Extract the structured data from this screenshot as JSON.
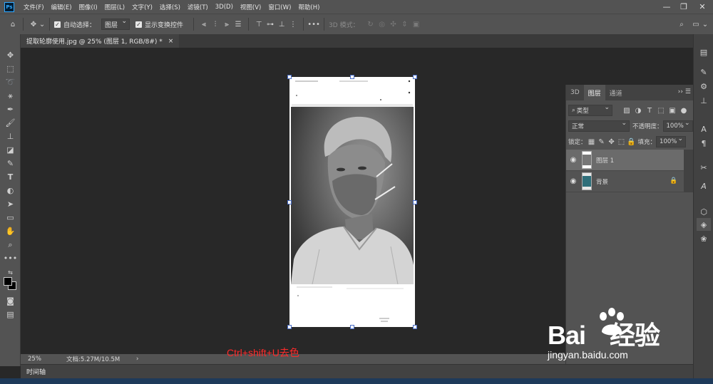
{
  "app": {
    "logo": "Ps",
    "menu": [
      "文件(F)",
      "编辑(E)",
      "图像(I)",
      "图层(L)",
      "文字(Y)",
      "选择(S)",
      "滤镜(T)",
      "3D(D)",
      "视图(V)",
      "窗口(W)",
      "帮助(H)"
    ],
    "window_controls": [
      "—",
      "❐",
      "✕"
    ]
  },
  "options": {
    "auto_select_label": "自动选择：",
    "auto_select_value": "图层",
    "show_transform_label": "显示变换控件",
    "mode_3d_label": "3D 模式："
  },
  "document": {
    "tab_title": "提取轮廓使用.jpg @ 25% (图层 1, RGB/8#) *",
    "tab_close": "×"
  },
  "status": {
    "zoom": "25%",
    "doc_info": "文档:5.27M/10.5M",
    "arrow": "›"
  },
  "timeline_label": "时间轴",
  "layers_panel": {
    "tabs": [
      "3D",
      "图层",
      "通道"
    ],
    "filter_value": "类型",
    "blend_mode": "正常",
    "opacity_label": "不透明度：",
    "opacity_value": "100%",
    "lock_label": "锁定：",
    "fill_label": "填充：",
    "fill_value": "100%",
    "layers": [
      {
        "name": "图层 1",
        "visible": true,
        "locked": false
      },
      {
        "name": "背景",
        "visible": true,
        "locked": true
      }
    ]
  },
  "caption": "Ctrl+shift+U去色",
  "watermark": {
    "brand": "Bai",
    "brand_cn": "经验",
    "url": "jingyan.baidu.com"
  },
  "colors": {
    "ui_dark": "#535353",
    "canvas_bg": "#282828",
    "accent_blue": "#31a8ff",
    "caption_red": "#ff2a2a"
  }
}
